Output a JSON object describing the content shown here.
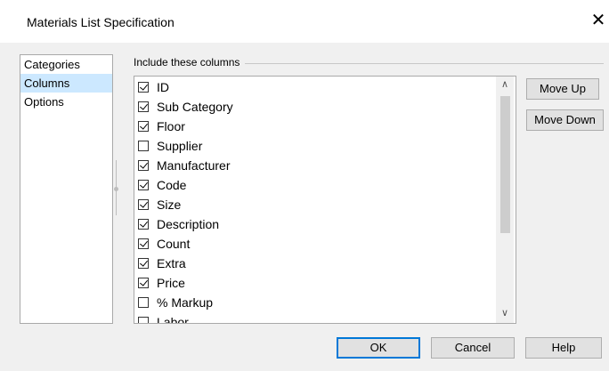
{
  "window": {
    "title": "Materials List Specification",
    "close_glyph": "✕"
  },
  "nav": {
    "items": [
      {
        "label": "Categories",
        "selected": false
      },
      {
        "label": "Columns",
        "selected": true
      },
      {
        "label": "Options",
        "selected": false
      }
    ]
  },
  "columns": {
    "group_label": "Include these columns",
    "items": [
      {
        "label": "ID",
        "checked": true
      },
      {
        "label": "Sub Category",
        "checked": true
      },
      {
        "label": "Floor",
        "checked": true
      },
      {
        "label": "Supplier",
        "checked": false
      },
      {
        "label": "Manufacturer",
        "checked": true
      },
      {
        "label": "Code",
        "checked": true
      },
      {
        "label": "Size",
        "checked": true
      },
      {
        "label": "Description",
        "checked": true
      },
      {
        "label": "Count",
        "checked": true
      },
      {
        "label": "Extra",
        "checked": true
      },
      {
        "label": "Price",
        "checked": true
      },
      {
        "label": "% Markup",
        "checked": false
      },
      {
        "label": "Labor",
        "checked": false
      }
    ],
    "scroll_up_glyph": "∧",
    "scroll_down_glyph": "∨"
  },
  "buttons": {
    "move_up": "Move Up",
    "move_down": "Move Down",
    "ok": "OK",
    "cancel": "Cancel",
    "help": "Help"
  }
}
